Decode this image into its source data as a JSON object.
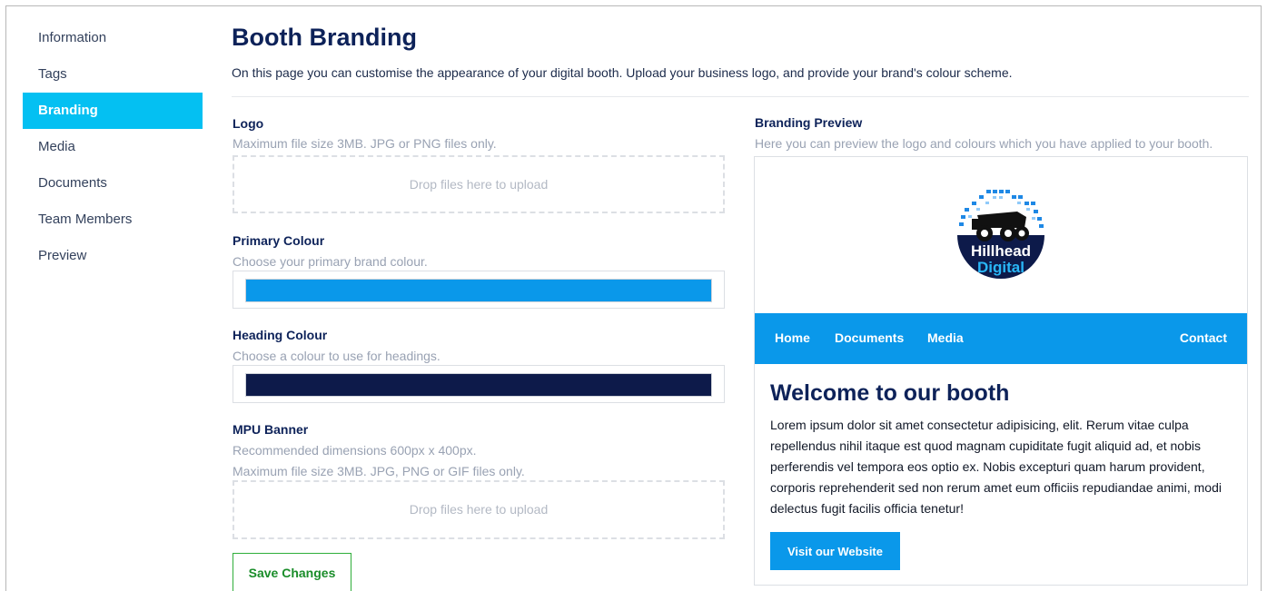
{
  "sidebar": {
    "items": [
      {
        "label": "Information"
      },
      {
        "label": "Tags"
      },
      {
        "label": "Branding"
      },
      {
        "label": "Media"
      },
      {
        "label": "Documents"
      },
      {
        "label": "Team Members"
      },
      {
        "label": "Preview"
      }
    ],
    "active": "Branding"
  },
  "header": {
    "title": "Booth Branding",
    "description": "On this page you can customise the appearance of your digital booth. Upload your business logo, and provide your brand's colour scheme."
  },
  "form": {
    "logo": {
      "label": "Logo",
      "hint": "Maximum file size 3MB. JPG or PNG files only.",
      "dropzone": "Drop files here to upload"
    },
    "primary_colour": {
      "label": "Primary Colour",
      "hint": "Choose your primary brand colour.",
      "value": "#0a98ea"
    },
    "heading_colour": {
      "label": "Heading Colour",
      "hint": "Choose a colour to use for headings.",
      "value": "#0d1a4a"
    },
    "mpu_banner": {
      "label": "MPU Banner",
      "hint_dimensions": "Recommended dimensions 600px x 400px.",
      "hint_size": "Maximum file size 3MB. JPG, PNG or GIF files only.",
      "dropzone": "Drop files here to upload"
    },
    "save_label": "Save Changes"
  },
  "preview": {
    "label": "Branding Preview",
    "hint": "Here you can preview the logo and colours which you have applied to your booth.",
    "logo_text_line1": "Hillhead",
    "logo_text_line2": "Digital",
    "nav": {
      "home": "Home",
      "documents": "Documents",
      "media": "Media",
      "contact": "Contact"
    },
    "heading": "Welcome to our booth",
    "body": "Lorem ipsum dolor sit amet consectetur adipisicing, elit. Rerum vitae culpa repellendus nihil itaque est quod magnam cupiditate fugit aliquid ad, et nobis perferendis vel tempora eos optio ex. Nobis excepturi quam harum provident, corporis reprehenderit sed non rerum amet eum officiis repudiandae animi, modi delectus fugit facilis officia tenetur!",
    "button_label": "Visit our Website"
  },
  "colors": {
    "sidebar_active": "#04c0f2",
    "primary": "#0a98ea",
    "heading": "#0d1a4a",
    "save_border": "#2fae3a"
  }
}
